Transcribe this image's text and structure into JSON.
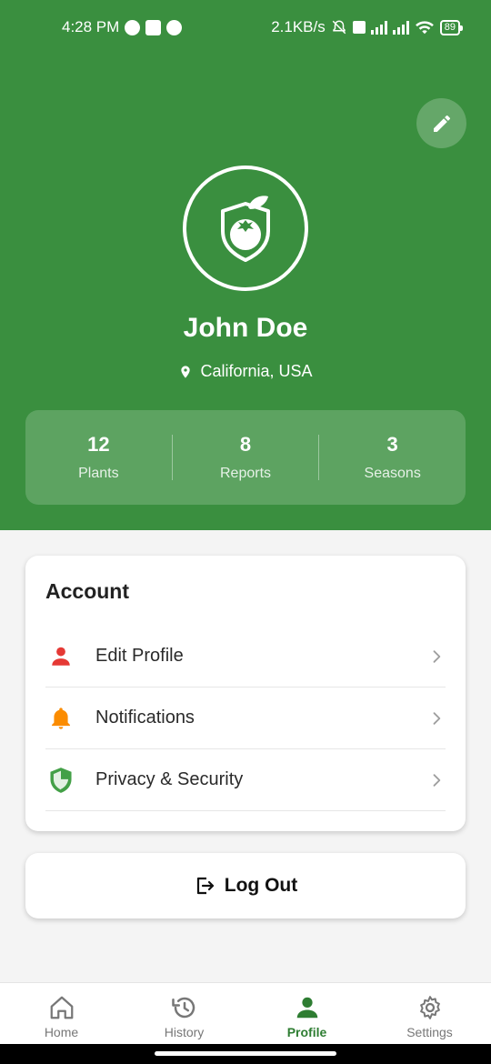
{
  "status_bar": {
    "time": "4:28 PM",
    "network_speed": "2.1KB/s",
    "battery": "89"
  },
  "profile": {
    "name": "John Doe",
    "location": "California, USA",
    "stats": [
      {
        "value": "12",
        "label": "Plants"
      },
      {
        "value": "8",
        "label": "Reports"
      },
      {
        "value": "3",
        "label": "Seasons"
      }
    ]
  },
  "account": {
    "title": "Account",
    "items": [
      {
        "label": "Edit Profile",
        "icon": "person-icon",
        "color": "#e53935"
      },
      {
        "label": "Notifications",
        "icon": "bell-icon",
        "color": "#fb8c00"
      },
      {
        "label": "Privacy & Security",
        "icon": "shield-icon",
        "color": "#43a047"
      }
    ]
  },
  "logout": {
    "label": "Log Out"
  },
  "bottom_nav": {
    "items": [
      {
        "label": "Home",
        "icon": "home-icon"
      },
      {
        "label": "History",
        "icon": "history-icon"
      },
      {
        "label": "Profile",
        "icon": "profile-icon",
        "active": true
      },
      {
        "label": "Settings",
        "icon": "gear-icon"
      }
    ]
  },
  "colors": {
    "primary": "#3a8f3f",
    "active_nav": "#2e7d32",
    "background": "#f4f4f4"
  }
}
